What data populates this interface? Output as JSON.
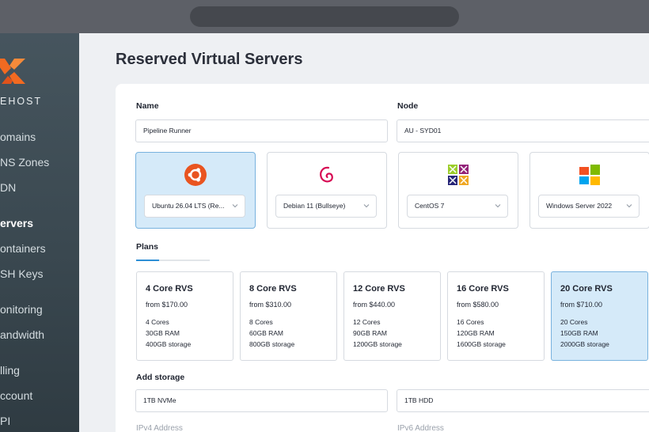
{
  "sidebar": {
    "brand": "EHOST",
    "items": [
      {
        "label": "omains"
      },
      {
        "label": "NS Zones"
      },
      {
        "label": "DN"
      },
      {
        "label": "ervers",
        "active": true
      },
      {
        "label": "ontainers"
      },
      {
        "label": "SH Keys"
      },
      {
        "label": "onitoring"
      },
      {
        "label": "andwidth"
      },
      {
        "label": "lling"
      },
      {
        "label": "ccount"
      },
      {
        "label": "PI"
      }
    ]
  },
  "page": {
    "title": "Reserved Virtual Servers"
  },
  "form": {
    "name_label": "Name",
    "name_value": "Pipeline Runner",
    "node_label": "Node",
    "node_value": "AU - SYD01"
  },
  "os_options": [
    {
      "label": "Ubuntu 26.04 LTS (Re...",
      "icon": "ubuntu-icon",
      "selected": true
    },
    {
      "label": "Debian 11 (Bullseye)",
      "icon": "debian-icon"
    },
    {
      "label": "CentOS 7",
      "icon": "centos-icon"
    },
    {
      "label": "Windows Server 2022",
      "icon": "windows-icon"
    }
  ],
  "plans_tab": "Plans",
  "plans": [
    {
      "name": "4 Core RVS",
      "price": "from $170.00",
      "cores": "4 Cores",
      "ram": "30GB RAM",
      "storage": "400GB storage"
    },
    {
      "name": "8 Core RVS",
      "price": "from $310.00",
      "cores": "8 Cores",
      "ram": "60GB RAM",
      "storage": "800GB storage"
    },
    {
      "name": "12 Core RVS",
      "price": "from $440.00",
      "cores": "12 Cores",
      "ram": "90GB RAM",
      "storage": "1200GB storage"
    },
    {
      "name": "16 Core RVS",
      "price": "from $580.00",
      "cores": "16 Cores",
      "ram": "120GB RAM",
      "storage": "1600GB storage"
    },
    {
      "name": "20 Core RVS",
      "price": "from $710.00",
      "cores": "20 Cores",
      "ram": "150GB RAM",
      "storage": "2000GB storage",
      "selected": true
    }
  ],
  "storage": {
    "label": "Add storage",
    "nvme": "1TB NVMe",
    "hdd": "1TB HDD"
  },
  "network": {
    "ipv4_label": "IPv4 Address",
    "ipv6_label": "IPv6 Address"
  },
  "colors": {
    "accent": "#2d8fd5",
    "selected_bg": "#d5eaf9",
    "logo_orange": "#f26a21"
  }
}
